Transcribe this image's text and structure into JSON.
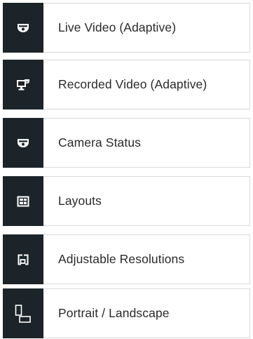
{
  "features": {
    "items": [
      {
        "icon": "dome-camera-icon",
        "label": "Live Video (Adaptive)"
      },
      {
        "icon": "monitor-camera-icon",
        "label": "Recorded Video (Adaptive)"
      },
      {
        "icon": "dome-camera-icon",
        "label": "Camera Status"
      },
      {
        "icon": "layout-grid-icon",
        "label": "Layouts"
      },
      {
        "icon": "resolution-frame-icon",
        "label": "Adjustable Resolutions"
      },
      {
        "icon": "portrait-landscape-icon",
        "label": "Portrait / Landscape"
      }
    ]
  },
  "colors": {
    "icon_background": "#1c2429",
    "icon_foreground": "#ffffff",
    "label_text": "#2a2a2a",
    "item_border": "#d9d9d9"
  }
}
